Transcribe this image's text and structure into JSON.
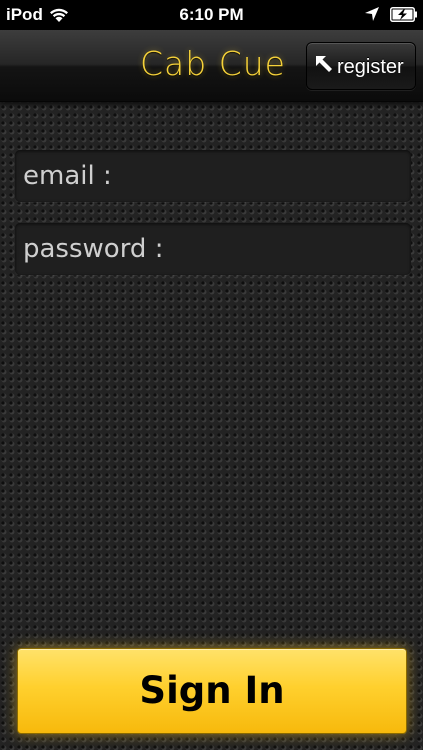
{
  "status_bar": {
    "carrier": "iPod",
    "time": "6:10 PM",
    "icons": [
      "wifi-icon",
      "location-icon",
      "battery-charging-icon"
    ]
  },
  "nav": {
    "title": "Cab Cue",
    "register_label": "register",
    "register_icon": "arrow-up-left-icon"
  },
  "form": {
    "email_placeholder": "email :",
    "email_value": "",
    "password_placeholder": "password :",
    "password_value": ""
  },
  "actions": {
    "signin_label": "Sign In"
  },
  "colors": {
    "accent": "#f6d23a",
    "signin_background": "#ffd02e",
    "background": "#232323"
  }
}
